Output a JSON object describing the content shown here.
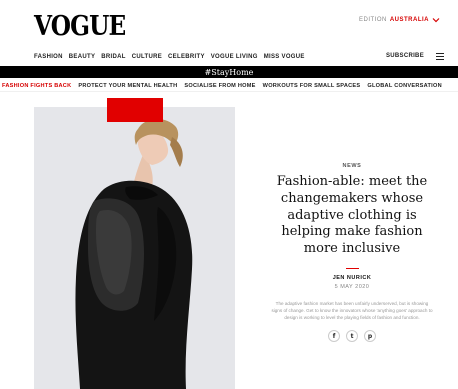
{
  "header": {
    "logo": "VOGUE",
    "edition_label": "EDITION",
    "edition_value": "AUSTRALIA"
  },
  "nav": {
    "items": [
      "FASHION",
      "BEAUTY",
      "BRIDAL",
      "CULTURE",
      "CELEBRITY",
      "VOGUE LIVING",
      "MISS VOGUE"
    ],
    "subscribe": "SUBSCRIBE"
  },
  "banner": "#StayHome",
  "subnav": {
    "items": [
      "FASHION FIGHTS BACK",
      "PROTECT YOUR MENTAL HEALTH",
      "SOCIALISE FROM HOME",
      "WORKOUTS FOR SMALL SPACES",
      "GLOBAL CONVERSATION"
    ]
  },
  "article": {
    "category": "NEWS",
    "headline": "Fashion-able: meet the changemakers whose adaptive clothing is helping make fashion more inclusive",
    "author": "JEN NURICK",
    "date": "5 MAY 2020",
    "excerpt": "The adaptive fashion market has been unfairly underserved, but is showing signs of change. Get to know the innovators whose 'anything goes' approach to design is working to level the playing fields of fashion and function.",
    "share": [
      "f",
      "t",
      "p"
    ]
  },
  "colors": {
    "accent": "#d60000",
    "banner_bg": "#000000",
    "hero_bg": "#e5e6ea"
  },
  "icons": [
    "chevron-down-icon",
    "hamburger-menu-icon",
    "facebook-icon",
    "twitter-icon",
    "pinterest-icon"
  ]
}
